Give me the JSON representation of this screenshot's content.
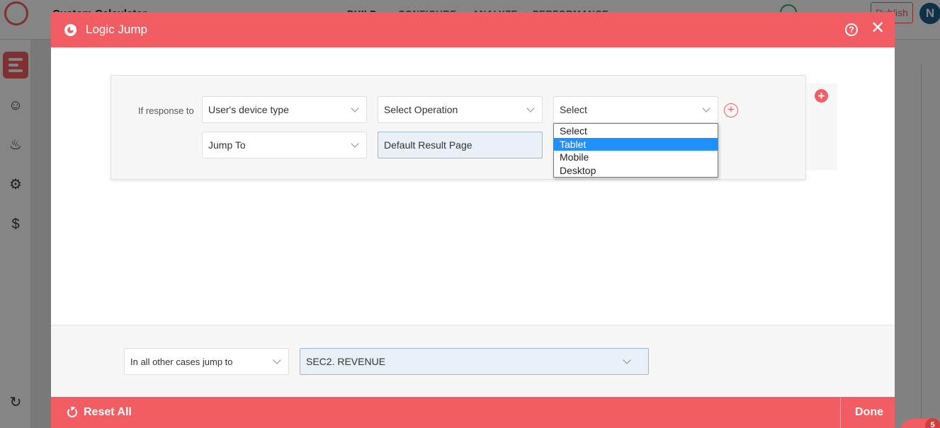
{
  "background": {
    "app_title": "Custom Calculator",
    "nav": [
      "BUILD",
      "CONFIGURE",
      "ANALYZE",
      "PERFORMANCE"
    ],
    "publish_label": "Publish",
    "avatar_initial": "N",
    "chat_badge": "5"
  },
  "modal": {
    "title": "Logic Jump",
    "condition": {
      "label": "If response to",
      "question": "User's device type",
      "operation": "Select Operation",
      "value": "Select",
      "jump_label": "Jump To",
      "jump_target": "Default Result Page"
    },
    "value_dropdown": {
      "options": [
        "Select",
        "Tablet",
        "Mobile",
        "Desktop"
      ],
      "highlighted": "Tablet"
    },
    "fallback": {
      "label": "In all other cases jump to",
      "target": "SEC2. REVENUE"
    },
    "footer": {
      "reset_label": "Reset All",
      "done_label": "Done"
    }
  },
  "colors": {
    "accent": "#f25c63",
    "highlight": "#1e90ff"
  }
}
